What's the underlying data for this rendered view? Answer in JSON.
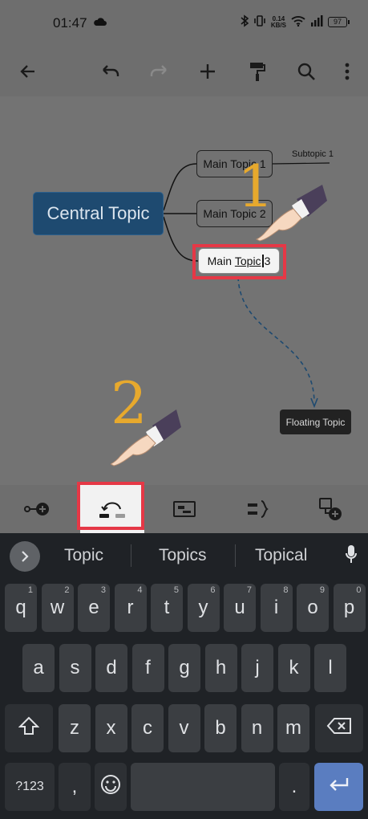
{
  "status": {
    "time": "01:47",
    "net_speed_value": "0.14",
    "net_speed_unit": "KB/S",
    "battery": "97"
  },
  "toolbar": {
    "icons": [
      "back-arrow-icon",
      "undo-icon",
      "redo-icon",
      "add-icon",
      "format-paint-icon",
      "search-icon",
      "more-vert-icon"
    ]
  },
  "mindmap": {
    "central_topic": "Central Topic",
    "main_topics": [
      "Main Topic 1",
      "Main Topic 2"
    ],
    "editing_topic": {
      "before_cursor": "Main ",
      "underlined": "Topic",
      "after_cursor": "3"
    },
    "subtopic": "Subtopic 1",
    "floating_topic": "Floating Topic",
    "step1": "1",
    "step2": "2"
  },
  "tools": {
    "icons": [
      "add-subtopic-icon",
      "relationship-icon",
      "summary-box-icon",
      "boundary-icon",
      "add-floating-topic-icon"
    ]
  },
  "keyboard": {
    "suggestions": [
      "Topic",
      "Topics",
      "Topical"
    ],
    "row1": [
      [
        "q",
        "1"
      ],
      [
        "w",
        "2"
      ],
      [
        "e",
        "3"
      ],
      [
        "r",
        "4"
      ],
      [
        "t",
        "5"
      ],
      [
        "y",
        "6"
      ],
      [
        "u",
        "7"
      ],
      [
        "i",
        "8"
      ],
      [
        "o",
        "9"
      ],
      [
        "p",
        "0"
      ]
    ],
    "row2": [
      "a",
      "s",
      "d",
      "f",
      "g",
      "h",
      "j",
      "k",
      "l"
    ],
    "row3": [
      "z",
      "x",
      "c",
      "v",
      "b",
      "n",
      "m"
    ],
    "symbols_key": "?123",
    "comma_key": ",",
    "period_key": "."
  },
  "colors": {
    "highlight": "#e53846",
    "central_topic": "#1e4a70",
    "step_number": "#e7a92d",
    "enter_key": "#5a7dc0"
  }
}
